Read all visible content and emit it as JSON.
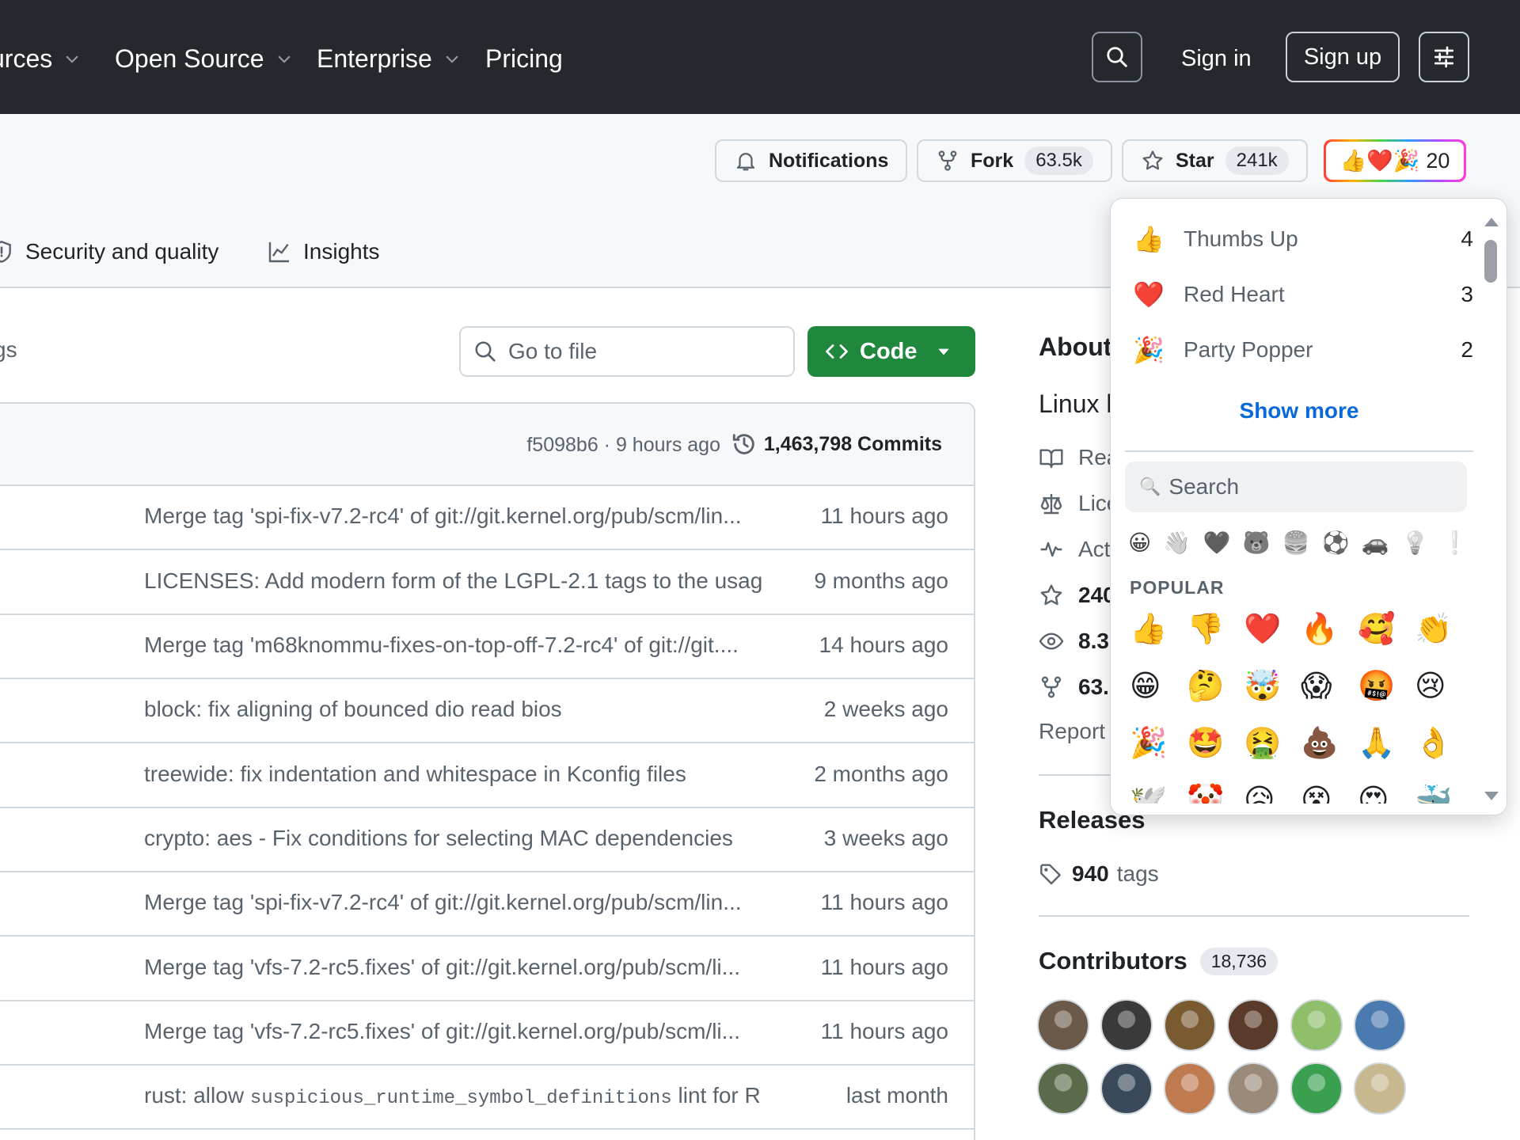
{
  "nav": {
    "items": [
      "urces",
      "Open Source",
      "Enterprise",
      "Pricing"
    ],
    "sign_in": "Sign in",
    "sign_up": "Sign up"
  },
  "repo_actions": {
    "notifications": "Notifications",
    "fork": "Fork",
    "fork_count": "63.5k",
    "star": "Star",
    "star_count": "241k",
    "reactions_emoji": "👍❤️🎉",
    "reactions_count": "20"
  },
  "tabs": {
    "security": "Security and quality",
    "insights": "Insights"
  },
  "main": {
    "branches_fragment": "gs",
    "go_to_file_placeholder": "Go to file",
    "code_button": "Code",
    "latest_commit": "f5098b6 · 9 hours ago",
    "commits_count": "1,463,798 Commits",
    "files": [
      {
        "message": "Merge tag 'spi-fix-v7.2-rc4' of git://git.kernel.org/pub/scm/lin...",
        "time": "11 hours ago"
      },
      {
        "message": "LICENSES: Add modern form of the LGPL-2.1 tags to the usag...",
        "time": "9 months ago"
      },
      {
        "message": "Merge tag 'm68knommu-fixes-on-top-off-7.2-rc4' of git://git....",
        "time": "14 hours ago"
      },
      {
        "message": "block: fix aligning of bounced dio read bios",
        "time": "2 weeks ago"
      },
      {
        "message": "treewide: fix indentation and whitespace in Kconfig files",
        "time": "2 months ago"
      },
      {
        "message": "crypto: aes - Fix conditions for selecting MAC dependencies",
        "time": "3 weeks ago"
      },
      {
        "message": "Merge tag 'spi-fix-v7.2-rc4' of git://git.kernel.org/pub/scm/lin...",
        "time": "11 hours ago"
      },
      {
        "message": "Merge tag 'vfs-7.2-rc5.fixes' of git://git.kernel.org/pub/scm/li...",
        "time": "11 hours ago"
      },
      {
        "message": "Merge tag 'vfs-7.2-rc5.fixes' of git://git.kernel.org/pub/scm/li...",
        "time": "11 hours ago"
      },
      {
        "message_pre": "rust: allow ",
        "message_code": "suspicious_runtime_symbol_definitions",
        "message_post": " lint for Ru...",
        "time": "last month"
      }
    ]
  },
  "sidebar": {
    "about": "About",
    "description": "Linux l",
    "readme": "Rea",
    "license": "Lice",
    "activity": "Act",
    "stars": "240",
    "watchers": "8.3",
    "forks": "63.",
    "report": "Report",
    "releases": "Releases",
    "tags_count": "940",
    "tags_label": "tags",
    "contributors": "Contributors",
    "contributors_count": "18,736",
    "avatar_colors": [
      "#6b5a4a",
      "#3a3a3a",
      "#7a5a30",
      "#5a3a2a",
      "#8fbf6a",
      "#4a7ab0",
      "#5a6a4a",
      "#3a4a5a",
      "#c07a50",
      "#9a8a7a",
      "#3aa050",
      "#c8b890"
    ]
  },
  "popover": {
    "reactions": [
      {
        "emoji": "👍",
        "name": "Thumbs Up",
        "count": "4"
      },
      {
        "emoji": "❤️",
        "name": "Red Heart",
        "count": "3"
      },
      {
        "emoji": "🎉",
        "name": "Party Popper",
        "count": "2"
      }
    ],
    "show_more": "Show more",
    "search_icon": "🔍",
    "search_placeholder": "Search",
    "categories": [
      "😀",
      "👋",
      "🖤",
      "🐻",
      "🍔",
      "⚽",
      "🚗",
      "💡",
      "❕"
    ],
    "popular_label": "POPULAR",
    "popular": [
      "👍",
      "👎",
      "❤️",
      "🔥",
      "🥰",
      "👏",
      "😁",
      "🤔",
      "🤯",
      "😱",
      "🤬",
      "😢",
      "🎉",
      "🤩",
      "🤮",
      "💩",
      "🙏",
      "👌",
      "🕊️",
      "🤡",
      "😥",
      "😵",
      "😍",
      "🐳"
    ]
  }
}
